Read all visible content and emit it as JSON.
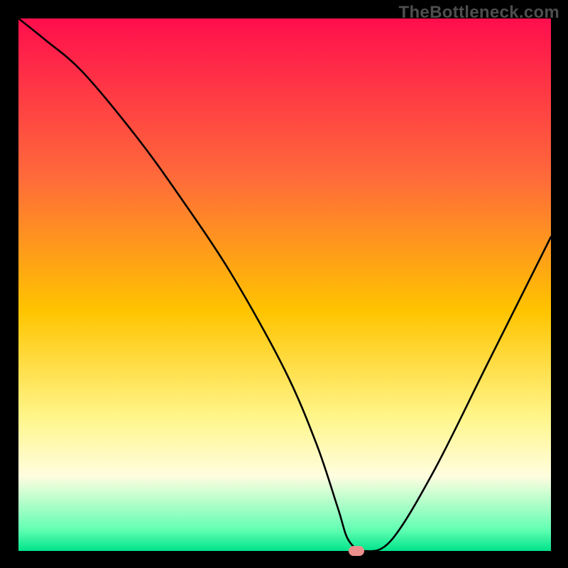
{
  "watermark": "TheBottleneck.com",
  "chart_data": {
    "type": "line",
    "title": "",
    "xlabel": "",
    "ylabel": "",
    "xlim": [
      0,
      100
    ],
    "ylim": [
      0,
      100
    ],
    "background_gradient": {
      "type": "vertical",
      "stops": [
        {
          "pos": 0,
          "color": "#ff0e4d"
        },
        {
          "pos": 30,
          "color": "#ff6b3a"
        },
        {
          "pos": 55,
          "color": "#ffc400"
        },
        {
          "pos": 75,
          "color": "#fff68b"
        },
        {
          "pos": 86,
          "color": "#fffde0"
        },
        {
          "pos": 96,
          "color": "#62ffb3"
        },
        {
          "pos": 100,
          "color": "#00e38a"
        }
      ]
    },
    "series": [
      {
        "name": "bottleneck-curve",
        "stroke": "#000000",
        "x": [
          0,
          5,
          12,
          22,
          30,
          40,
          50,
          56,
          60,
          62,
          65,
          70,
          78,
          88,
          98,
          100
        ],
        "values": [
          100,
          96,
          90,
          78,
          67,
          52,
          34,
          20,
          8,
          2,
          0,
          2,
          15,
          35,
          55,
          59
        ]
      }
    ],
    "flat_region": {
      "x_start": 58,
      "x_end": 66,
      "y": 0
    },
    "marker": {
      "x": 63.5,
      "y": 0,
      "color": "#eb8f8c"
    }
  }
}
